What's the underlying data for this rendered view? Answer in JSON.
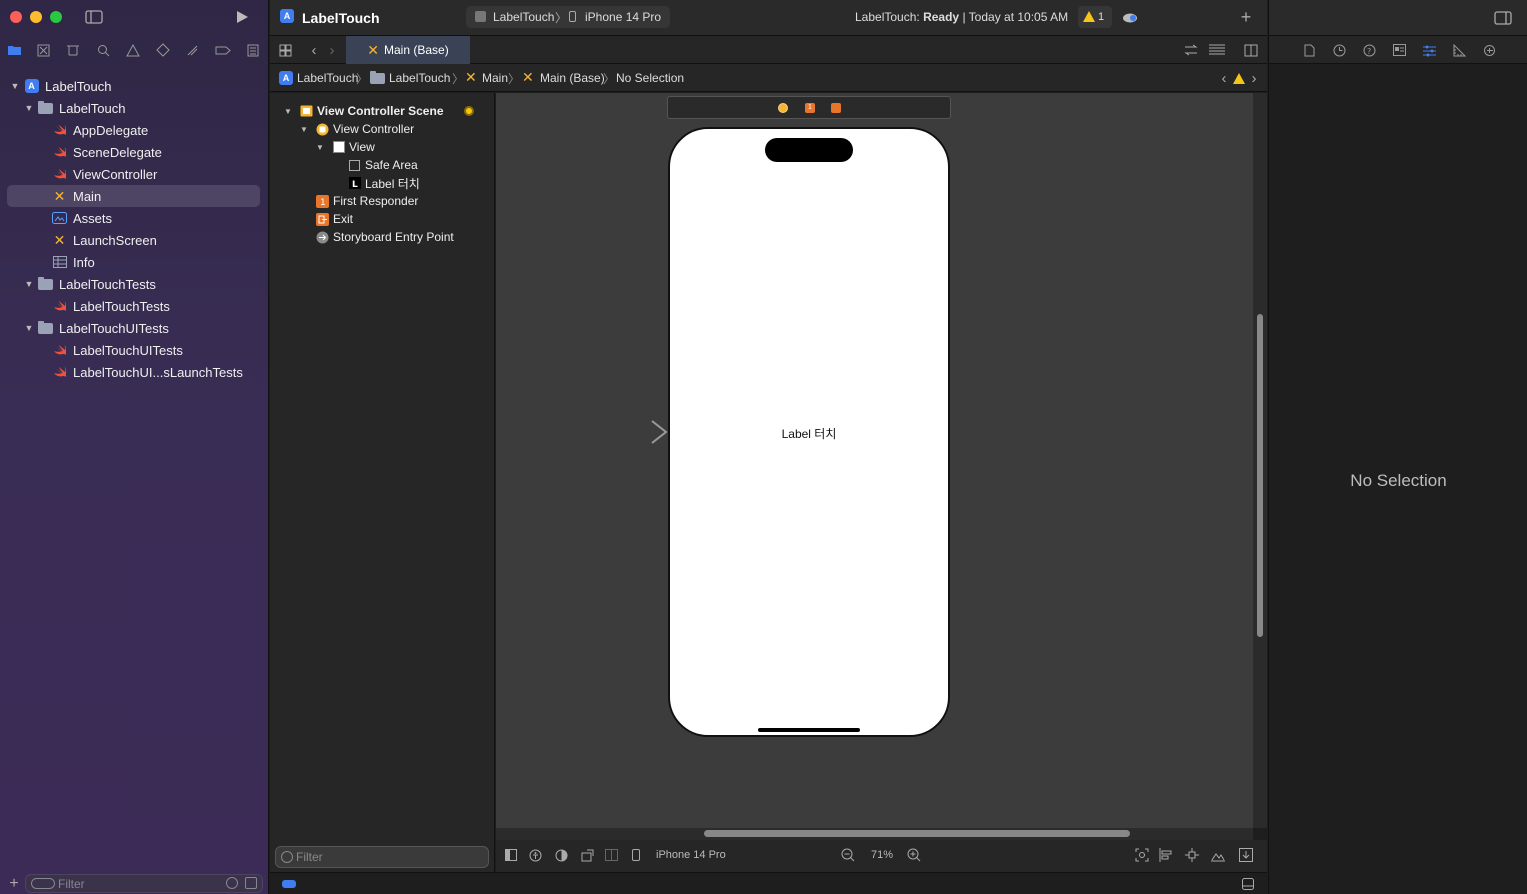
{
  "window": {
    "project": "LabelTouch"
  },
  "toolbar": {
    "scheme": "LabelTouch",
    "device": "iPhone 14 Pro",
    "status_prefix": "LabelTouch: ",
    "status_state": "Ready",
    "status_time": "| Today at 10:05 AM",
    "warning_count": "1"
  },
  "sidebar": {
    "items": [
      {
        "label": "LabelTouch",
        "icon": "project-icon",
        "depth": 0,
        "chevron": true
      },
      {
        "label": "LabelTouch",
        "icon": "folder-icon",
        "depth": 1,
        "chevron": true
      },
      {
        "label": "AppDelegate",
        "icon": "swift-file-icon",
        "depth": 2
      },
      {
        "label": "SceneDelegate",
        "icon": "swift-file-icon",
        "depth": 2
      },
      {
        "label": "ViewController",
        "icon": "swift-file-icon",
        "depth": 2
      },
      {
        "label": "Main",
        "icon": "storyboard-icon",
        "depth": 2,
        "selected": true
      },
      {
        "label": "Assets",
        "icon": "asset-catalog-icon",
        "depth": 2
      },
      {
        "label": "LaunchScreen",
        "icon": "storyboard-icon",
        "depth": 2
      },
      {
        "label": "Info",
        "icon": "plist-icon",
        "depth": 2
      },
      {
        "label": "LabelTouchTests",
        "icon": "folder-icon",
        "depth": 1,
        "chevron": true
      },
      {
        "label": "LabelTouchTests",
        "icon": "swift-file-icon",
        "depth": 2
      },
      {
        "label": "LabelTouchUITests",
        "icon": "folder-icon",
        "depth": 1,
        "chevron": true
      },
      {
        "label": "LabelTouchUITests",
        "icon": "swift-file-icon",
        "depth": 2
      },
      {
        "label": "LabelTouchUI...sLaunchTests",
        "icon": "swift-file-icon",
        "depth": 2
      }
    ],
    "filter_placeholder": "Filter"
  },
  "editor": {
    "tab_label": "Main (Base)",
    "breadcrumb": [
      "LabelTouch",
      "LabelTouch",
      "Main",
      "Main (Base)",
      "No Selection"
    ],
    "outline": [
      {
        "label": "View Controller Scene",
        "indent": 0,
        "chevron": true,
        "bold": true
      },
      {
        "label": "View Controller",
        "indent": 1,
        "chevron": true
      },
      {
        "label": "View",
        "indent": 2,
        "chevron": true
      },
      {
        "label": "Safe Area",
        "indent": 3
      },
      {
        "label": "Label 터치",
        "indent": 3
      },
      {
        "label": "First Responder",
        "indent": 1
      },
      {
        "label": "Exit",
        "indent": 1
      },
      {
        "label": "Storyboard Entry Point",
        "indent": 1
      }
    ],
    "outline_filter_placeholder": "Filter",
    "canvas_label": "Label 터치",
    "bottom_device": "iPhone 14 Pro",
    "zoom": "71%"
  },
  "inspector": {
    "empty_text": "No Selection"
  },
  "colors": {
    "accent": "#3f7df0",
    "swift": "#f05138",
    "storyboard": "#f5b533",
    "warning": "#f5c518"
  }
}
